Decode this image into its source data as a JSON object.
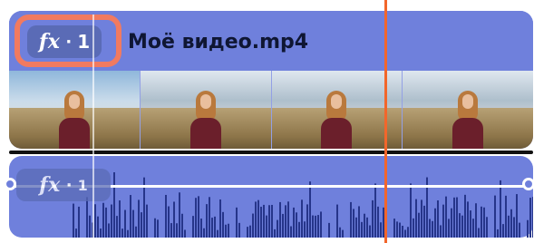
{
  "video_track": {
    "title": "Моё видео.mp4",
    "fx_badge": {
      "fx": "fx",
      "separator": "·",
      "count": "1"
    },
    "thumbnail_count": 4
  },
  "audio_track": {
    "fx_badge": {
      "fx": "fx",
      "separator": "·",
      "count": "1"
    }
  },
  "colors": {
    "clip_bg": "#6f80dc",
    "badge_bg": "#5a6bb6",
    "highlight": "#f17a60",
    "playhead": "#f2662b",
    "title_text": "#0f1633",
    "wave": "#26358a"
  },
  "icons": {
    "effects": "fx-icon",
    "volume_handle": "volume-handle-icon"
  }
}
